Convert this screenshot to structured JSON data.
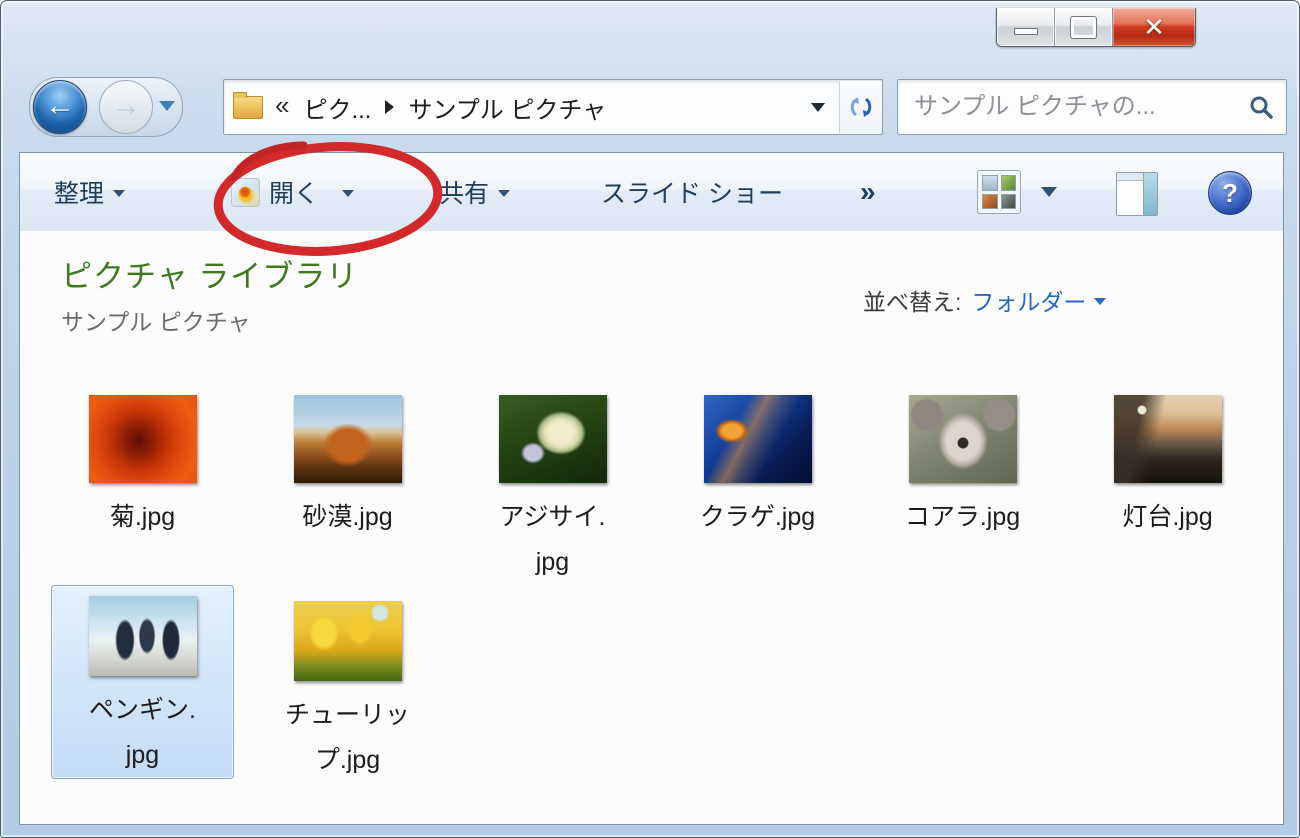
{
  "window": {
    "controls": {
      "close_glyph": "✕"
    }
  },
  "nav": {
    "breadcrumb": {
      "overflow_glyph": "«",
      "parent": "ピク...",
      "current": "サンプル ピクチャ"
    },
    "search": {
      "placeholder": "サンプル ピクチャの..."
    }
  },
  "toolbar": {
    "organize": {
      "label": "整理"
    },
    "open": {
      "label": "開く"
    },
    "share": {
      "label": "共有"
    },
    "slideshow": {
      "label": "スライド ショー"
    },
    "more": {
      "label": "»"
    },
    "help_glyph": "?"
  },
  "header": {
    "title": "ピクチャ ライブラリ",
    "subtitle": "サンプル ピクチャ",
    "sort_label": "並べ替え:",
    "sort_value": "フォルダー"
  },
  "files": [
    {
      "name": "菊.jpg",
      "label_lines": [
        "菊.jpg"
      ],
      "selected": false
    },
    {
      "name": "砂漠.jpg",
      "label_lines": [
        "砂漠.jpg"
      ],
      "selected": false
    },
    {
      "name": "アジサイ.jpg",
      "label_lines": [
        "アジサイ.",
        "jpg"
      ],
      "selected": false
    },
    {
      "name": "クラゲ.jpg",
      "label_lines": [
        "クラゲ.jpg"
      ],
      "selected": false
    },
    {
      "name": "コアラ.jpg",
      "label_lines": [
        "コアラ.jpg"
      ],
      "selected": false
    },
    {
      "name": "灯台.jpg",
      "label_lines": [
        "灯台.jpg"
      ],
      "selected": false
    },
    {
      "name": "ペンギン.jpg",
      "label_lines": [
        "ペンギン.",
        "jpg"
      ],
      "selected": true
    },
    {
      "name": "チューリップ.jpg",
      "label_lines": [
        "チューリッ",
        "プ.jpg"
      ],
      "selected": false
    }
  ],
  "colors": {
    "title_green": "#3e7a1e",
    "link_blue": "#2468c8",
    "annotation_red": "#d3292b",
    "selection_border": "#84a7d3",
    "close_red": "#ce3a20"
  },
  "annotation": {
    "shape": "hand-drawn-circle",
    "around": "開く button"
  }
}
